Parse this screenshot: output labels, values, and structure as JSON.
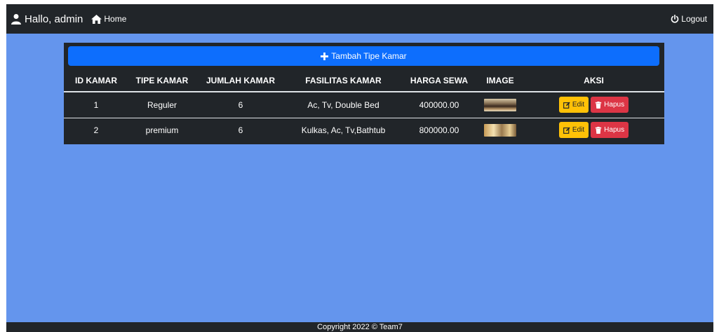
{
  "navbar": {
    "greeting": "Hallo, admin",
    "home_label": "Home",
    "logout_label": "Logout",
    "icons": {
      "user": "user-icon",
      "home": "home-icon",
      "logout": "power-icon"
    }
  },
  "panel": {
    "add_button_label": "Tambah Tipe Kamar",
    "add_icon": "plus-icon"
  },
  "table": {
    "headers": [
      "ID KAMAR",
      "TIPE KAMAR",
      "JUMLAH KAMAR",
      "FASILITAS KAMAR",
      "HARGA SEWA",
      "IMAGE",
      "AKSI"
    ],
    "rows": [
      {
        "id": "1",
        "tipe": "Reguler",
        "jumlah": "6",
        "fasilitas": "Ac, Tv, Double Bed",
        "harga": "400000.00",
        "image": "room-thumbnail"
      },
      {
        "id": "2",
        "tipe": "premium",
        "jumlah": "6",
        "fasilitas": "Kulkas, Ac, Tv,Bathtub",
        "harga": "800000.00",
        "image": "room-thumbnail"
      }
    ],
    "edit_label": "Edit",
    "hapus_label": "Hapus"
  },
  "footer": {
    "text": "Copyright 2022 © Team7"
  },
  "colors": {
    "page_bg": "#6495ed",
    "dark": "#212529",
    "primary": "#0d6efd",
    "warning": "#ffc107",
    "danger": "#dc3545"
  }
}
